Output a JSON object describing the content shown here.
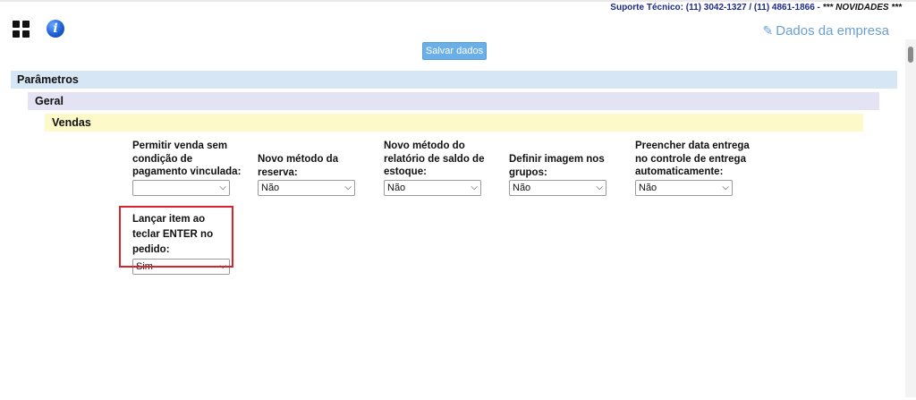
{
  "header": {
    "support_text": "Suporte Técnico: (11) 3042-1327 / (11) 4861-1866 - ",
    "novidades": "*** NOVIDADES ***",
    "company_link": "Dados da empresa"
  },
  "toolbar": {
    "save_label": "Salvar dados"
  },
  "sections": {
    "parametros": "Parâmetros",
    "geral": "Geral",
    "vendas": "Vendas"
  },
  "fields": [
    {
      "label": "Permitir venda sem condição de pagamento vinculada:",
      "value": ""
    },
    {
      "label": "Novo método da reserva:",
      "value": "Não"
    },
    {
      "label": "Novo método do relatório de saldo de estoque:",
      "value": "Não"
    },
    {
      "label": "Definir imagem nos grupos:",
      "value": "Não"
    },
    {
      "label": "Preencher data entrega no controle de entrega automaticamente:",
      "value": "Não"
    },
    {
      "label": "Lançar item ao teclar ENTER no pedido:",
      "value": "Sim"
    }
  ],
  "colors": {
    "highlight": "#d7252b",
    "save_button": "#6aafe8",
    "link": "#6a9fd4"
  },
  "icons": {
    "menu": "grid-icon",
    "info": "info-icon",
    "edit": "edit-icon"
  }
}
